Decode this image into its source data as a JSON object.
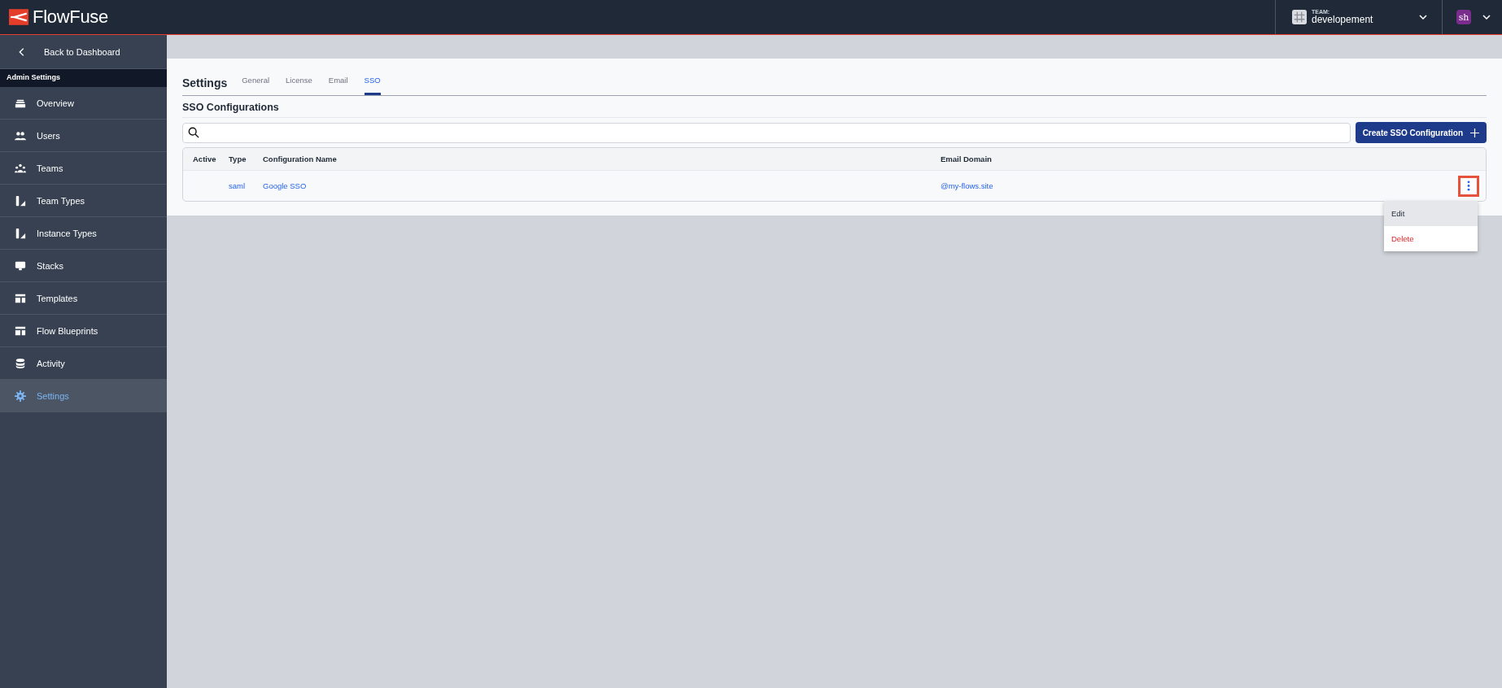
{
  "header": {
    "logo": "FlowFuse",
    "team": {
      "label": "TEAM:",
      "name": "developement"
    },
    "user": {
      "initials": "sh"
    }
  },
  "sidebar": {
    "back": "Back to Dashboard",
    "section": "Admin Settings",
    "items": [
      {
        "label": "Overview",
        "selected": false
      },
      {
        "label": "Users",
        "selected": false
      },
      {
        "label": "Teams",
        "selected": false
      },
      {
        "label": "Team Types",
        "selected": false
      },
      {
        "label": "Instance Types",
        "selected": false
      },
      {
        "label": "Stacks",
        "selected": false
      },
      {
        "label": "Templates",
        "selected": false
      },
      {
        "label": "Flow Blueprints",
        "selected": false
      },
      {
        "label": "Activity",
        "selected": false
      },
      {
        "label": "Settings",
        "selected": true
      }
    ]
  },
  "page": {
    "title": "Settings",
    "tabs": [
      {
        "label": "General",
        "selected": false
      },
      {
        "label": "License",
        "selected": false
      },
      {
        "label": "Email",
        "selected": false
      },
      {
        "label": "SSO",
        "selected": true
      }
    ],
    "section_title": "SSO Configurations",
    "create_button": "Create SSO Configuration",
    "table": {
      "columns": [
        "Active",
        "Type",
        "Configuration Name",
        "Email Domain"
      ],
      "rows": [
        {
          "type": "saml",
          "name": "Google SSO",
          "domain": "@my-flows.site",
          "menu_highlighted": true
        }
      ]
    },
    "row_menu": [
      {
        "label": "Edit",
        "kind": "normal",
        "selected": true
      },
      {
        "label": "Delete",
        "kind": "danger",
        "selected": false
      }
    ]
  }
}
